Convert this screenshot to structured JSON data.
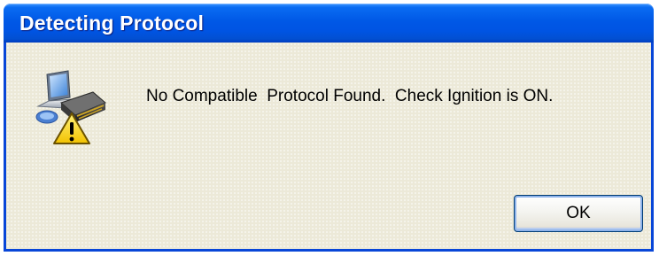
{
  "window": {
    "title": "Detecting Protocol",
    "accent_color": "#0054e3",
    "background_color": "#ece9d8"
  },
  "dialog": {
    "icon": "network-device-warning-icon",
    "message": "No Compatible  Protocol Found.  Check Ignition is ON.",
    "ok_label": "OK"
  }
}
